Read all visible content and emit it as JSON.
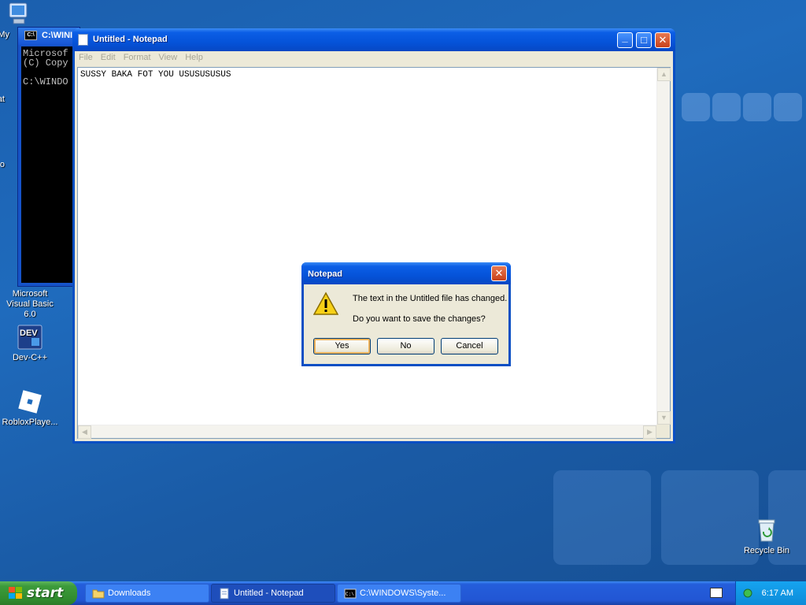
{
  "desktop": {
    "icons": [
      {
        "label": "My"
      },
      {
        "label": "Dat"
      },
      {
        "label": "Micro"
      },
      {
        "label": "Microsoft Visual Basic 6.0"
      },
      {
        "label": "Dev-C++"
      },
      {
        "label": "RobloxPlaye..."
      },
      {
        "label": "Recycle Bin"
      }
    ],
    "dev_badge": "DEV"
  },
  "cmd_window": {
    "title": "C:\\WINI",
    "icon_text": "C:\\",
    "console_lines": [
      "Microsof",
      "(C) Copy",
      "",
      "C:\\WINDO"
    ]
  },
  "notepad": {
    "title": "Untitled - Notepad",
    "menu": [
      "File",
      "Edit",
      "Format",
      "View",
      "Help"
    ],
    "content": "SUSSY BAKA FOT YOU USUSUSUSUS",
    "caption_buttons": {
      "minimize": "_",
      "maximize": "□",
      "close": "✕"
    }
  },
  "dialog": {
    "title": "Notepad",
    "message_line1": "The text in the Untitled file has changed.",
    "message_line2": "Do you want to save the changes?",
    "buttons": {
      "yes": "Yes",
      "no": "No",
      "cancel": "Cancel"
    },
    "close_glyph": "✕"
  },
  "taskbar": {
    "start_label": "start",
    "tasks": [
      {
        "label": "Downloads",
        "icon": "folder-icon"
      },
      {
        "label": "Untitled - Notepad",
        "icon": "notepad-icon"
      },
      {
        "label": "C:\\WINDOWS\\Syste...",
        "icon": "cmd-icon"
      }
    ],
    "clock": "6:17 AM"
  },
  "colors": {
    "desktop": "#1f6bbd",
    "titlebar": "#0553d9",
    "start_button": "#3d9b3b",
    "dialog_bg": "#ece9d8",
    "close_button": "#c8401a"
  }
}
